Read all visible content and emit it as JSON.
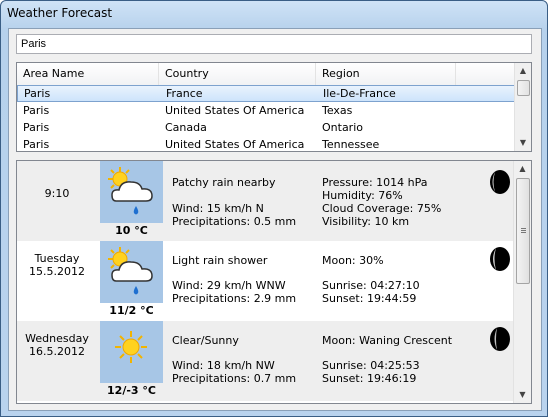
{
  "window": {
    "title": "Weather Forecast"
  },
  "search": {
    "value": "Paris"
  },
  "grid": {
    "columns": [
      "Area Name",
      "Country",
      "Region"
    ],
    "rows": [
      {
        "area": "Paris",
        "country": "France",
        "region": "Ile-De-France",
        "selected": true
      },
      {
        "area": "Paris",
        "country": "United States Of America",
        "region": "Texas"
      },
      {
        "area": "Paris",
        "country": "Canada",
        "region": "Ontario"
      },
      {
        "area": "Paris",
        "country": "United States Of America",
        "region": "Tennessee"
      }
    ]
  },
  "forecast": [
    {
      "time": "9:10",
      "temp": "10 °C",
      "icon": "patchy-rain-icon",
      "condition": "Patchy rain nearby",
      "wind": "Wind: 15 km/h N",
      "precip": "Precipitations: 0.5 mm",
      "info1": "Pressure: 1014 hPa",
      "info2": "Humidity: 76%",
      "info3": "Cloud Coverage: 75%",
      "info4": "Visibility: 10 km"
    },
    {
      "day": "Tuesday",
      "date": "15.5.2012",
      "temp": "11/2 °C",
      "icon": "light-rain-shower-icon",
      "condition": "Light rain shower",
      "wind": "Wind: 29 km/h WNW",
      "precip": "Precipitations: 2.9 mm",
      "moon": "Moon: 30%",
      "sunrise": "Sunrise: 04:27:10",
      "sunset": "Sunset: 19:44:59"
    },
    {
      "day": "Wednesday",
      "date": "16.5.2012",
      "temp": "12/-3 °C",
      "icon": "sunny-icon",
      "condition": "Clear/Sunny",
      "wind": "Wind: 18 km/h NW",
      "precip": "Precipitations: 0.7 mm",
      "moon": "Moon: Waning Crescent",
      "sunrise": "Sunrise: 04:25:53",
      "sunset": "Sunset: 19:46:19"
    }
  ]
}
